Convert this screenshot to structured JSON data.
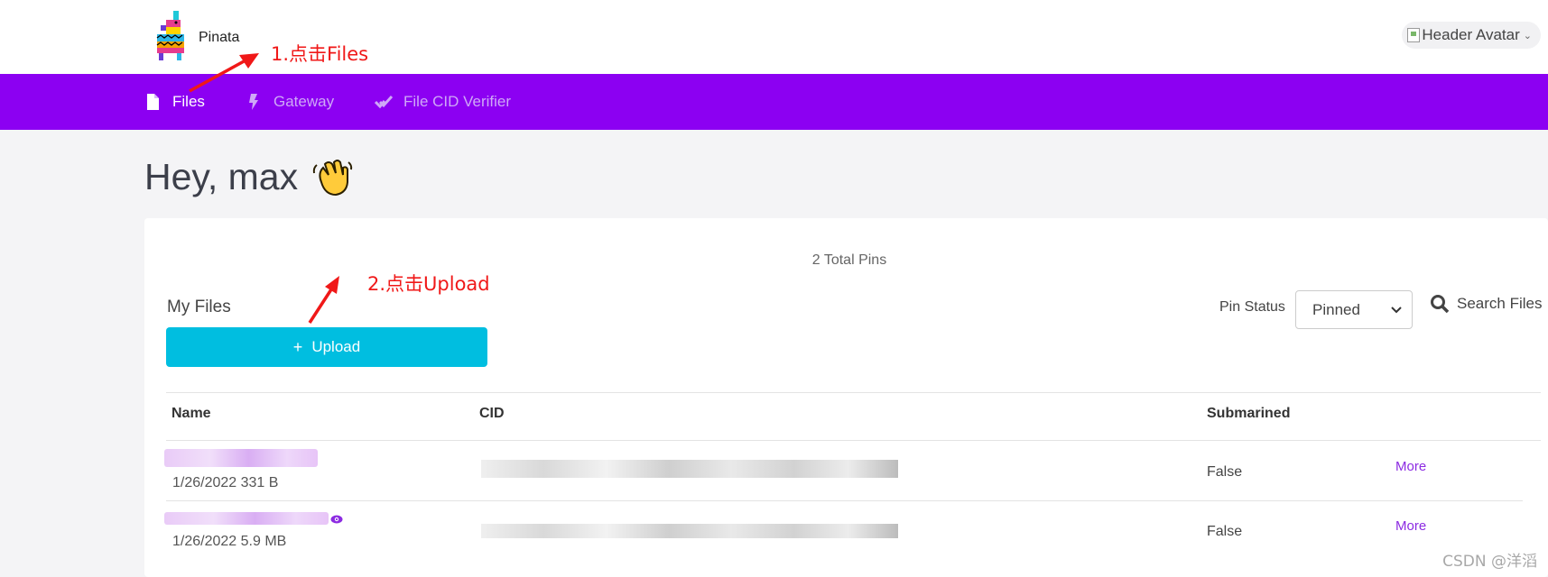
{
  "header": {
    "brand": "Pinata",
    "avatar_alt": "Header Avatar",
    "logo_icon": "llama-pinata-logo"
  },
  "nav": {
    "items": [
      {
        "label": "Files",
        "icon": "file-icon",
        "active": true
      },
      {
        "label": "Gateway",
        "icon": "bolt-icon",
        "active": false
      },
      {
        "label": "File CID Verifier",
        "icon": "check-double-icon",
        "active": false
      }
    ]
  },
  "annotations": {
    "step1": "1.点击Files",
    "step2": "2.点击Upload",
    "color": "#f01818"
  },
  "greeting": {
    "text": "Hey, max",
    "emoji": "waving-hand"
  },
  "files": {
    "total_pins": "2 Total Pins",
    "title": "My Files",
    "upload_label": "Upload",
    "pin_status_label": "Pin Status",
    "pin_status_value": "Pinned",
    "search_label": "Search Files",
    "columns": [
      "Name",
      "CID",
      "Submarined"
    ],
    "rows": [
      {
        "meta": "1/26/2022 331 B",
        "submarined": "False",
        "action": "More"
      },
      {
        "meta": "1/26/2022 5.9 MB",
        "submarined": "False",
        "action": "More"
      }
    ]
  },
  "watermark": "CSDN @洋滔",
  "colors": {
    "nav_bg": "#8c00f2",
    "upload_bg": "#00bee0",
    "link": "#8c2be2"
  }
}
